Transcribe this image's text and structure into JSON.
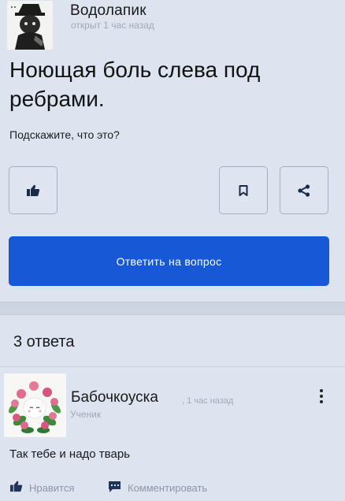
{
  "question": {
    "author": "Водолапик",
    "meta": "открыт 1 час назад",
    "title": "Ноющая боль слева под ребрами.",
    "body": "Подскажите, что это?"
  },
  "actions": {
    "like_icon": "thumbs-up-icon",
    "bookmark_icon": "bookmark-icon",
    "share_icon": "share-icon"
  },
  "answer_button": "Ответить на вопрос",
  "answers_count": "3 ответа",
  "answer": {
    "author": "Бабочкоуска",
    "time": ", 1 час назад",
    "rank": "Ученик",
    "text": "Так тебе и надо тварь",
    "like_label": "Нравится",
    "comment_label": "Комментировать"
  },
  "colors": {
    "primary": "#1758d6",
    "background": "#dde3ef",
    "muted_text": "#a2a8b8"
  }
}
